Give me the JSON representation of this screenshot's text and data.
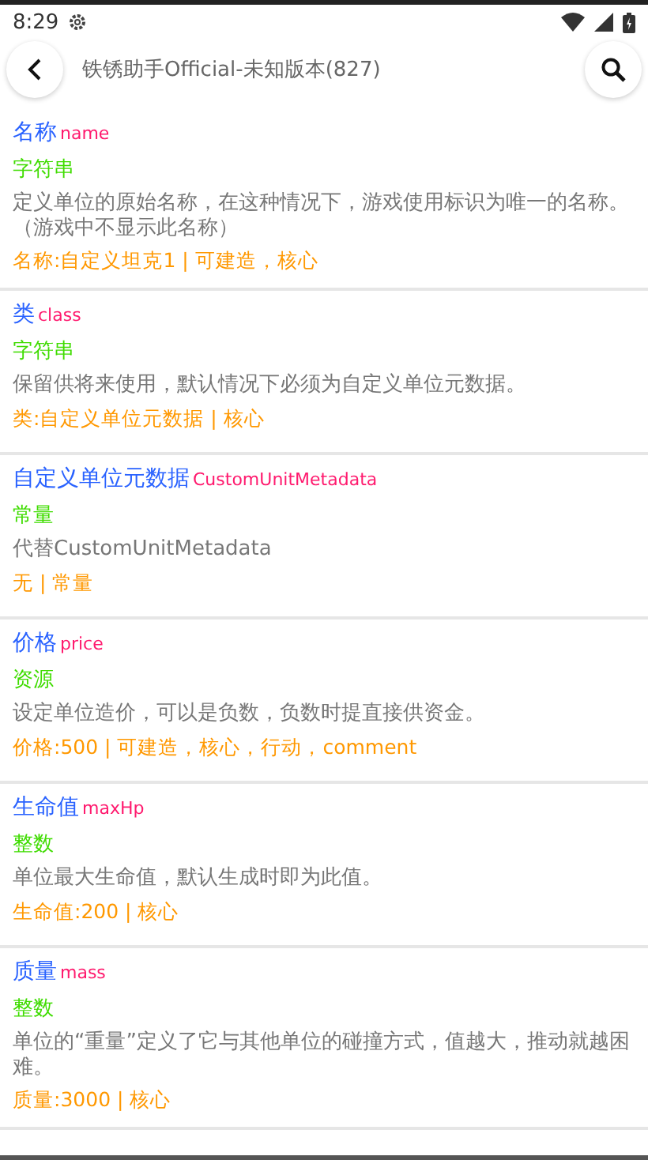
{
  "status_bar": {
    "time": "8:29"
  },
  "toolbar": {
    "title": "铁锈助手Official-未知版本(827)"
  },
  "entries": [
    {
      "title": "名称",
      "key": "name",
      "type": "字符串",
      "description": "定义单位的原始名称，在这种情况下，游戏使用标识为唯一的名称。（游戏中不显示此名称）",
      "usage": "名称:自定义坦克1 | 可建造，核心"
    },
    {
      "title": "类",
      "key": "class",
      "type": "字符串",
      "description": "保留供将来使用，默认情况下必须为自定义单位元数据。",
      "usage": "类:自定义单位元数据 | 核心"
    },
    {
      "title": "自定义单位元数据",
      "key": "CustomUnitMetadata",
      "type": "常量",
      "description": "代替CustomUnitMetadata",
      "usage": "无 | 常量"
    },
    {
      "title": "价格",
      "key": "price",
      "type": "资源",
      "description": "设定单位造价，可以是负数，负数时提直接供资金。",
      "usage": "价格:500 | 可建造，核心，行动，comment"
    },
    {
      "title": "生命值",
      "key": "maxHp",
      "type": "整数",
      "description": "单位最大生命值，默认生成时即为此值。",
      "usage": "生命值:200 | 核心"
    },
    {
      "title": "质量",
      "key": "mass",
      "type": "整数",
      "description": "单位的“重量”定义了它与其他单位的碰撞方式，值越大，推动就越困难。",
      "usage": "质量:3000 | 核心"
    }
  ]
}
